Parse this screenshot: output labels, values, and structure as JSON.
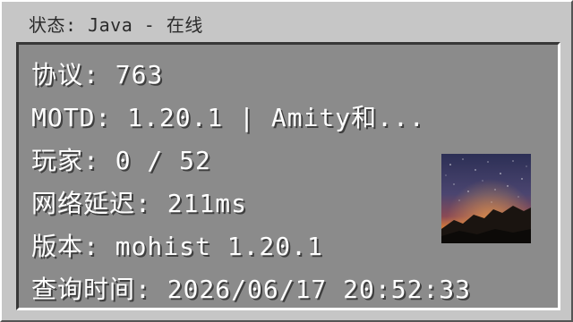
{
  "window": {
    "title": "状态: Java - 在线"
  },
  "info": {
    "protocol": "协议: 763",
    "motd": "MOTD: 1.20.1 | Amity和...",
    "players": "玩家: 0 / 52",
    "latency": "网络延迟: 211ms",
    "version": "版本: mohist 1.20.1",
    "query_time": "查询时间: 2026/06/17 20:52:33"
  },
  "server_icon": {
    "icon": "starry-night-mountain-image"
  }
}
